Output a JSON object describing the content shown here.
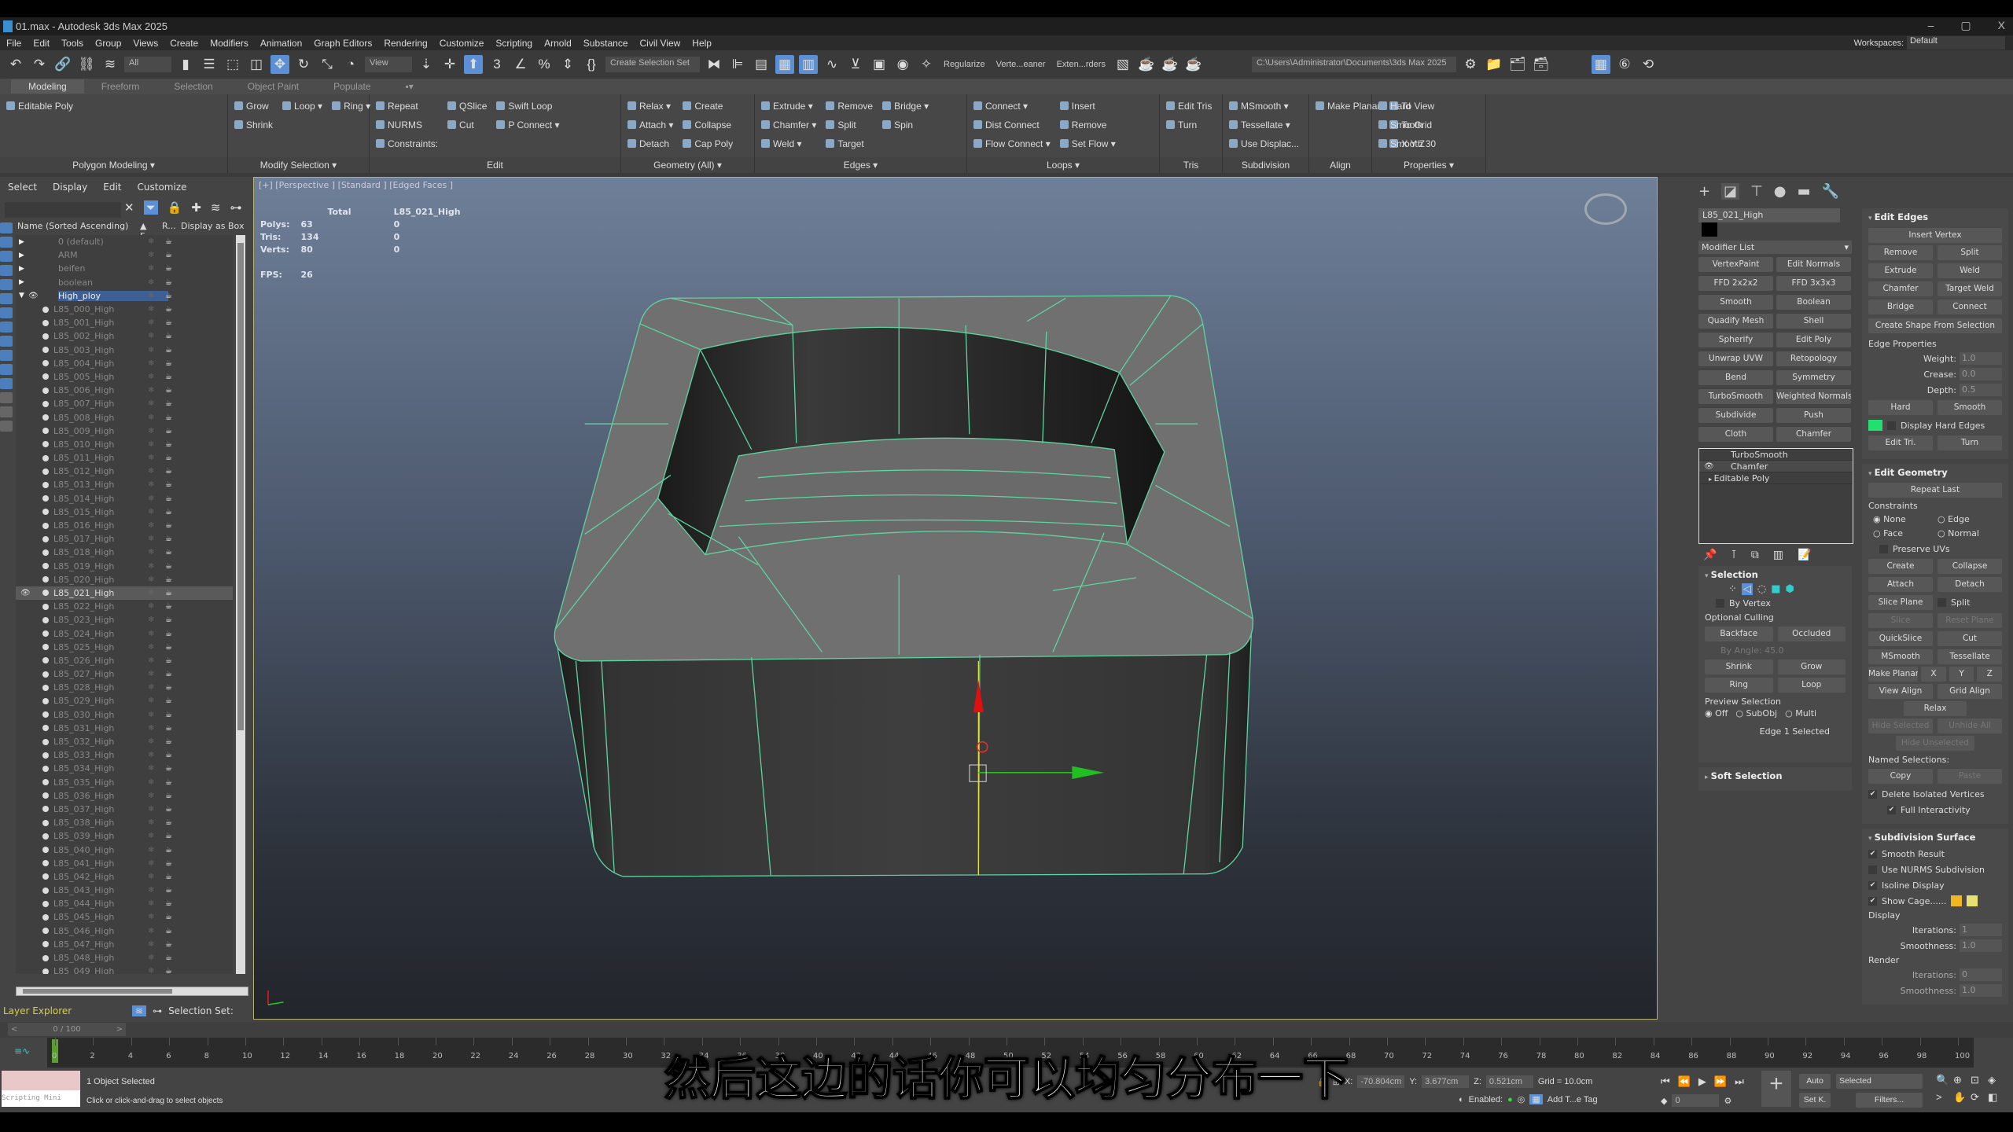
{
  "window": {
    "title": "01.max - Autodesk 3ds Max 2025",
    "min": "–",
    "max": "▢",
    "close": "X"
  },
  "menu": [
    "File",
    "Edit",
    "Tools",
    "Group",
    "Views",
    "Create",
    "Modifiers",
    "Animation",
    "Graph Editors",
    "Rendering",
    "Customize",
    "Scripting",
    "Arnold",
    "Substance",
    "Civil View",
    "Help"
  ],
  "workspaces": {
    "label": "Workspaces:",
    "value": "Default"
  },
  "toolbar": {
    "filter": "All",
    "refcoord": "View",
    "selset": "Create Selection Set",
    "scripts": [
      "Regularize",
      "Verte...eaner",
      "Exten...rders"
    ],
    "path": "C:\\Users\\Administrator\\Documents\\3ds Max 2025"
  },
  "ribbon": {
    "tabs": [
      "Modeling",
      "Freeform",
      "Selection",
      "Object Paint",
      "Populate"
    ],
    "groups": [
      {
        "label": "Polygon Modeling ▾",
        "columns": [
          [
            "Editable Poly"
          ]
        ]
      },
      {
        "label": "Modify Selection ▾",
        "columns": [
          [
            "Grow",
            "Shrink"
          ],
          [
            "Loop ▾"
          ],
          [
            "Ring ▾"
          ]
        ]
      },
      {
        "label": "Edit",
        "columns": [
          [
            "Repeat",
            "NURMS",
            "Constraints:"
          ],
          [
            "QSlice",
            "Cut"
          ],
          [
            "Swift Loop",
            "P Connect ▾"
          ]
        ]
      },
      {
        "label": "Geometry (All) ▾",
        "columns": [
          [
            "Relax ▾",
            "Attach ▾",
            "Detach"
          ],
          [
            "Create",
            "Collapse",
            "Cap Poly"
          ]
        ]
      },
      {
        "label": "Edges ▾",
        "columns": [
          [
            "Extrude ▾",
            "Chamfer ▾",
            "Weld ▾"
          ],
          [
            "Remove",
            "Split",
            "Target"
          ],
          [
            "Bridge ▾",
            "Spin"
          ]
        ]
      },
      {
        "label": "Loops ▾",
        "columns": [
          [
            "Connect ▾",
            "Dist Connect",
            "Flow Connect ▾"
          ],
          [
            "Insert",
            "Remove",
            "Set Flow ▾"
          ]
        ]
      },
      {
        "label": "Tris",
        "columns": [
          [
            "Edit Tris",
            "Turn"
          ]
        ]
      },
      {
        "label": "Subdivision",
        "columns": [
          [
            "MSmooth ▾",
            "Tessellate ▾",
            "Use Displac..."
          ]
        ]
      },
      {
        "label": "Align",
        "columns": [
          [
            "Make Planar"
          ],
          [
            "To View",
            "To Grid",
            "X Y Z"
          ]
        ]
      },
      {
        "label": "Properties ▾",
        "columns": [
          [
            "Hard",
            "Smooth",
            "Smooth 30"
          ]
        ]
      }
    ]
  },
  "explorer": {
    "menu": [
      "Select",
      "Display",
      "Edit",
      "Customize"
    ],
    "columns": [
      "Name (Sorted Ascending)",
      "▲ F...",
      "R...",
      "Display as Box"
    ],
    "layers": [
      "0 (default)",
      "ARM",
      "beifen",
      "boolean",
      "High_ploy"
    ],
    "objects": [
      "L85_000_High",
      "L85_001_High",
      "L85_002_High",
      "L85_003_High",
      "L85_004_High",
      "L85_005_High",
      "L85_006_High",
      "L85_007_High",
      "L85_008_High",
      "L85_009_High",
      "L85_010_High",
      "L85_011_High",
      "L85_012_High",
      "L85_013_High",
      "L85_014_High",
      "L85_015_High",
      "L85_016_High",
      "L85_017_High",
      "L85_018_High",
      "L85_019_High",
      "L85_020_High",
      "L85_021_High",
      "L85_022_High",
      "L85_023_High",
      "L85_024_High",
      "L85_025_High",
      "L85_026_High",
      "L85_027_High",
      "L85_028_High",
      "L85_029_High",
      "L85_030_High",
      "L85_031_High",
      "L85_032_High",
      "L85_033_High",
      "L85_034_High",
      "L85_035_High",
      "L85_036_High",
      "L85_037_High",
      "L85_038_High",
      "L85_039_High",
      "L85_040_High",
      "L85_041_High",
      "L85_042_High",
      "L85_043_High",
      "L85_044_High",
      "L85_045_High",
      "L85_046_High",
      "L85_047_High",
      "L85_048_High",
      "L85_049_High"
    ],
    "selected_object": "L85_021_High",
    "active_layer": "High_ploy",
    "footer": {
      "mode": "Layer Explorer",
      "selset": "Selection Set:"
    }
  },
  "viewport": {
    "label": "[+] [Perspective ] [Standard ] [Edged Faces ]",
    "stats": {
      "h_total": "Total",
      "h_obj": "L85_021_High",
      "polys_label": "Polys:",
      "polys": "63",
      "polys_obj": "0",
      "tris_label": "Tris:",
      "tris": "134",
      "tris_obj": "0",
      "verts_label": "Verts:",
      "verts": "80",
      "verts_obj": "0",
      "fps_label": "FPS:",
      "fps": "26"
    },
    "wire_color": "#5fd3a0"
  },
  "subtitle": "然后这边的话你可以均匀分布一下",
  "command": {
    "object_name": "L85_021_High",
    "modifier_list": "Modifier List",
    "modifier_buttons": [
      "VertexPaint",
      "Edit Normals",
      "FFD 2x2x2",
      "FFD 3x3x3",
      "Smooth",
      "Boolean",
      "Quadify Mesh",
      "Shell",
      "Spherify",
      "Edit Poly",
      "Unwrap UVW",
      "Retopology",
      "Bend",
      "Symmetry",
      "TurboSmooth",
      "Weighted Normals",
      "Subdivide",
      "Push",
      "Cloth",
      "Chamfer"
    ],
    "stack": [
      "TurboSmooth",
      "Chamfer",
      "Editable Poly"
    ],
    "selection": {
      "title": "Selection",
      "by_vertex": "By Vertex",
      "culling": "Optional Culling",
      "backface": "Backface",
      "occluded": "Occluded",
      "by_angle": "By Angle:",
      "angle": "45.0",
      "shrink": "Shrink",
      "grow": "Grow",
      "ring": "Ring",
      "loop": "Loop",
      "preview": "Preview Selection",
      "off": "Off",
      "subobj": "SubObj",
      "multi": "Multi",
      "status": "Edge 1 Selected"
    },
    "soft_selection": "Soft Selection",
    "edit_edges": {
      "title": "Edit Edges",
      "insert_vertex": "Insert Vertex",
      "remove": "Remove",
      "split": "Split",
      "extrude": "Extrude",
      "weld": "Weld",
      "chamfer": "Chamfer",
      "target_weld": "Target Weld",
      "bridge": "Bridge",
      "connect": "Connect",
      "create_shape": "Create Shape From Selection",
      "edge_props": "Edge Properties",
      "weight_label": "Weight:",
      "weight": "1.0",
      "crease_label": "Crease:",
      "crease": "0.0",
      "depth_label": "Depth:",
      "depth": "0.5",
      "hard": "Hard",
      "smooth": "Smooth",
      "display_hard": "Display Hard Edges",
      "hard_color": "#22e070",
      "edit_tri": "Edit Tri.",
      "turn": "Turn"
    },
    "edit_geometry": {
      "title": "Edit Geometry",
      "repeat_last": "Repeat Last",
      "constraints": "Constraints",
      "none": "None",
      "edge": "Edge",
      "face": "Face",
      "normal": "Normal",
      "preserve_uvs": "Preserve UVs",
      "create": "Create",
      "collapse": "Collapse",
      "attach": "Attach",
      "detach": "Detach",
      "slice_plane": "Slice Plane",
      "split": "Split",
      "slice": "Slice",
      "reset_plane": "Reset Plane",
      "quickslice": "QuickSlice",
      "cut": "Cut",
      "msmooth": "MSmooth",
      "tessellate": "Tessellate",
      "make_planar": "Make Planar",
      "x": "X",
      "y": "Y",
      "z": "Z",
      "view_align": "View Align",
      "grid_align": "Grid Align",
      "relax": "Relax",
      "hide_selected": "Hide Selected",
      "unhide_all": "Unhide All",
      "hide_unselected": "Hide Unselected",
      "named_sel": "Named Selections:",
      "copy": "Copy",
      "paste": "Paste",
      "delete_iso": "Delete Isolated Vertices",
      "full_inter": "Full Interactivity"
    },
    "subdivision": {
      "title": "Subdivision Surface",
      "smooth_result": "Smooth Result",
      "nurms": "Use NURMS Subdivision",
      "isoline": "Isoline Display",
      "show_cage": "Show Cage......",
      "cage_color1": "#f0b820",
      "cage_color2": "#e8e070",
      "display": "Display",
      "iter_label": "Iterations:",
      "iter": "1",
      "smooth_label": "Smoothness:",
      "smooth": "1.0",
      "render": "Render",
      "r_iter": "0",
      "r_smooth": "1.0"
    }
  },
  "timeline": {
    "range": "0 / 100",
    "ticks": [
      "0",
      "2",
      "4",
      "6",
      "8",
      "10",
      "12",
      "14",
      "16",
      "18",
      "20",
      "22",
      "24",
      "26",
      "28",
      "30",
      "32",
      "34",
      "36",
      "38",
      "40",
      "42",
      "44",
      "46",
      "48",
      "50",
      "52",
      "54",
      "56",
      "58",
      "60",
      "62",
      "64",
      "66",
      "68",
      "70",
      "72",
      "74",
      "76",
      "78",
      "80",
      "82",
      "84",
      "86",
      "88",
      "90",
      "92",
      "94",
      "96",
      "98",
      "100"
    ],
    "current_frame": 0
  },
  "status": {
    "selected": "1 Object Selected",
    "prompt": "Click or click-and-drag to select objects",
    "mini": "Scripting Mini",
    "x_label": "X:",
    "x": "-70.804cm",
    "y_label": "Y:",
    "y": "3.677cm",
    "z_label": "Z:",
    "z": "0.521cm",
    "grid": "Grid = 10.0cm",
    "enabled": "Enabled:",
    "tag": "Add T...e Tag",
    "auto": "Auto",
    "setk": "Set K.",
    "key_filter": "Selected",
    "filters": "Filters...",
    "frame": "0"
  }
}
